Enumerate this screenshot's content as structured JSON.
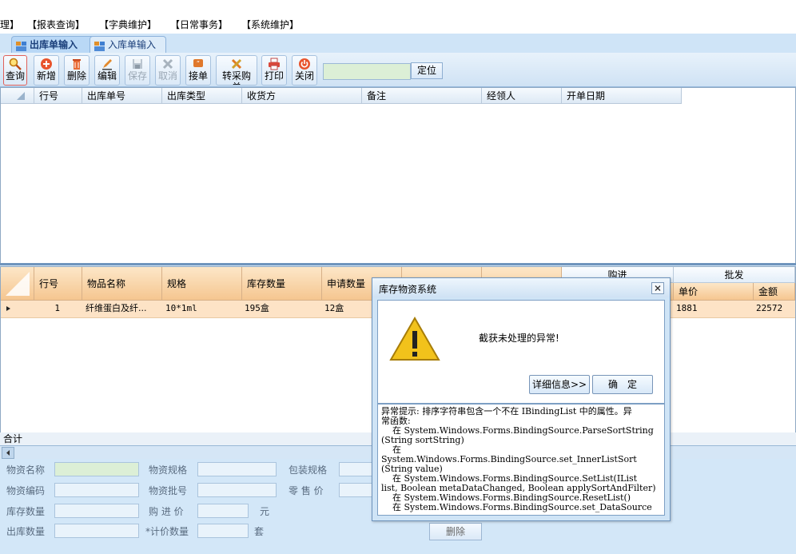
{
  "menu": {
    "items": [
      "理】",
      "【报表查询】",
      "【字典维护】",
      "【日常事务】",
      "【系统维护】"
    ]
  },
  "tabs": [
    {
      "label": "出库单输入",
      "active": true
    },
    {
      "label": "入库单输入",
      "active": false
    }
  ],
  "toolbar": {
    "buttons": [
      {
        "label": "查询",
        "icon": "search-icon",
        "enabled": true
      },
      {
        "label": "新增",
        "icon": "add-icon",
        "enabled": true
      },
      {
        "label": "删除",
        "icon": "trash-icon",
        "enabled": true
      },
      {
        "label": "编辑",
        "icon": "edit-icon",
        "enabled": true
      },
      {
        "label": "保存",
        "icon": "save-icon",
        "enabled": false
      },
      {
        "label": "取消",
        "icon": "cancel-icon",
        "enabled": false
      },
      {
        "label": "接单",
        "icon": "receive-icon",
        "enabled": true
      },
      {
        "label": "转采购单",
        "icon": "convert-icon",
        "enabled": true
      },
      {
        "label": "打印",
        "icon": "print-icon",
        "enabled": true
      },
      {
        "label": "关闭",
        "icon": "power-icon",
        "enabled": true
      }
    ],
    "locate_value": "",
    "locate_label": "定位"
  },
  "top_grid": {
    "columns": [
      "行号",
      "出库单号",
      "出库类型",
      "收货方",
      "备注",
      "经领人",
      "开单日期"
    ]
  },
  "detail_grid": {
    "columns": [
      "行号",
      "物品名称",
      "规格",
      "库存数量",
      "申请数量"
    ],
    "group_headers": [
      "购进",
      "批发"
    ],
    "sub_columns": [
      "单价",
      "金额"
    ],
    "rows": [
      {
        "row": "1",
        "name": "纤维蛋白及纤...",
        "spec": "10*1ml",
        "stock": "195盒",
        "requested": "12盒",
        "price": "1881",
        "amount": "22572"
      }
    ],
    "total_label": "合计"
  },
  "form": {
    "item_name_label": "物资名称",
    "item_spec_label": "物资规格",
    "pack_spec_label": "包装规格",
    "item_code_label": "物资编码",
    "item_batch_label": "物资批号",
    "retail_price_label": "零 售 价",
    "stock_qty_label": "库存数量",
    "purchase_price_label": "购 进 价",
    "yuan_label": "元",
    "out_qty_label": "出库数量",
    "pricing_qty_label": "*计价数量",
    "set_label": "套",
    "delete_label": "删除"
  },
  "dialog": {
    "title": "库存物资系统",
    "message": "截获未处理的异常!",
    "details_button": "详细信息>>",
    "ok_button": "确　定",
    "detail_lines": [
      "异常提示: 排序字符串包含一个不在 IBindingList 中的属性。异",
      "常函数:",
      "    在 System.Windows.Forms.BindingSource.ParseSortString",
      "(String sortString)",
      "    在",
      "System.Windows.Forms.BindingSource.set_InnerListSort",
      "(String value)",
      "    在 System.Windows.Forms.BindingSource.SetList(IList",
      "list, Boolean metaDataChanged, Boolean applySortAndFilter)",
      "    在 System.Windows.Forms.BindingSource.ResetList()",
      "    在 System.Windows.Forms.BindingSource.set_DataSource"
    ]
  },
  "colors": {
    "header_orange": "#f5c690",
    "row_highlight": "#fde3c6",
    "window_bg": "#d6e9f7",
    "warning_yellow": "#f2c21b"
  }
}
